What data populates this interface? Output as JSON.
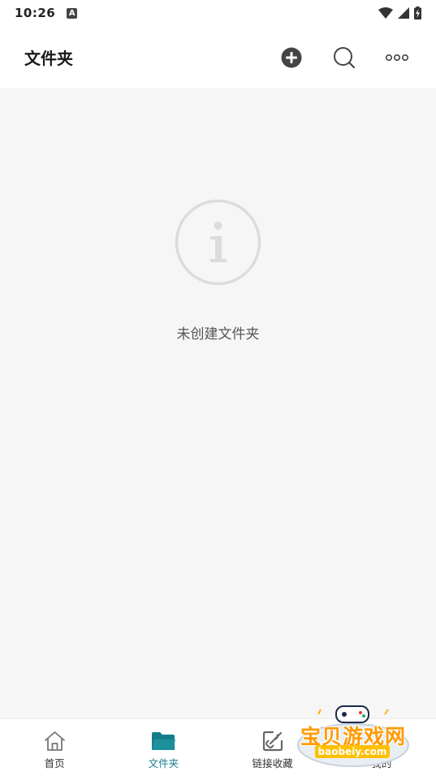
{
  "status_bar": {
    "time": "10:26",
    "notification_icon": "a-icon",
    "right_icons": [
      "wifi-icon",
      "signal-icon",
      "battery-charging-icon"
    ]
  },
  "header": {
    "title": "文件夹",
    "actions": [
      "add-circle-icon",
      "search-icon",
      "more-icon"
    ]
  },
  "empty_state": {
    "icon": "info-icon",
    "message": "未创建文件夹"
  },
  "bottom_nav": {
    "items": [
      {
        "label": "首页",
        "icon": "home-icon",
        "active": false
      },
      {
        "label": "文件夹",
        "icon": "folder-icon",
        "active": true
      },
      {
        "label": "链接收藏",
        "icon": "link-edit-icon",
        "active": false
      },
      {
        "label": "我的",
        "icon": "profile-icon",
        "active": false
      }
    ]
  },
  "watermark": {
    "text": "宝贝游戏网",
    "url": "baobeiy.com"
  },
  "colors": {
    "accent": "#157d8a",
    "background": "#f6f6f6",
    "icon_dark": "#444444",
    "watermark": "#ff9a00"
  }
}
